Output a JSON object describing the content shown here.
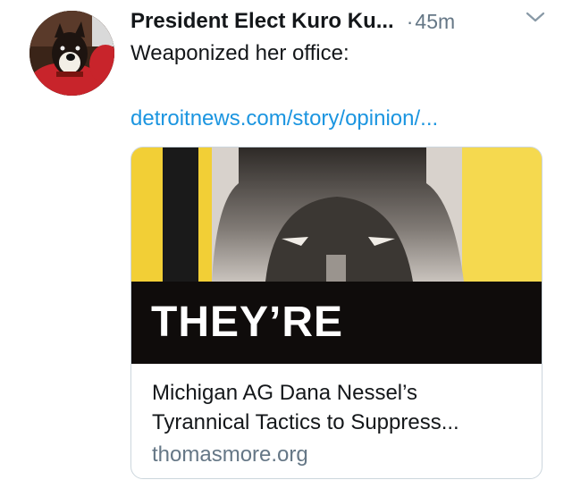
{
  "tweet": {
    "display_name": "President Elect Kuro Ku...",
    "time_separator": "·",
    "time": "45m",
    "text": "Weaponized her office:",
    "link": "detroitnews.com/story/opinion/...",
    "avatar_icon": "dog-avatar",
    "menu_icon": "chevron-down-icon"
  },
  "card": {
    "image_text": "THEY’RE",
    "title_line1": "Michigan AG Dana Nessel’s",
    "title_line2": "Tyrannical Tactics to Suppress...",
    "domain": "thomasmore.org"
  },
  "colors": {
    "link": "#1b95e0",
    "secondary_text": "#657786",
    "primary_text": "#14171a",
    "card_border": "#ccd6dd",
    "poster_yellow": "#f4d33e"
  }
}
